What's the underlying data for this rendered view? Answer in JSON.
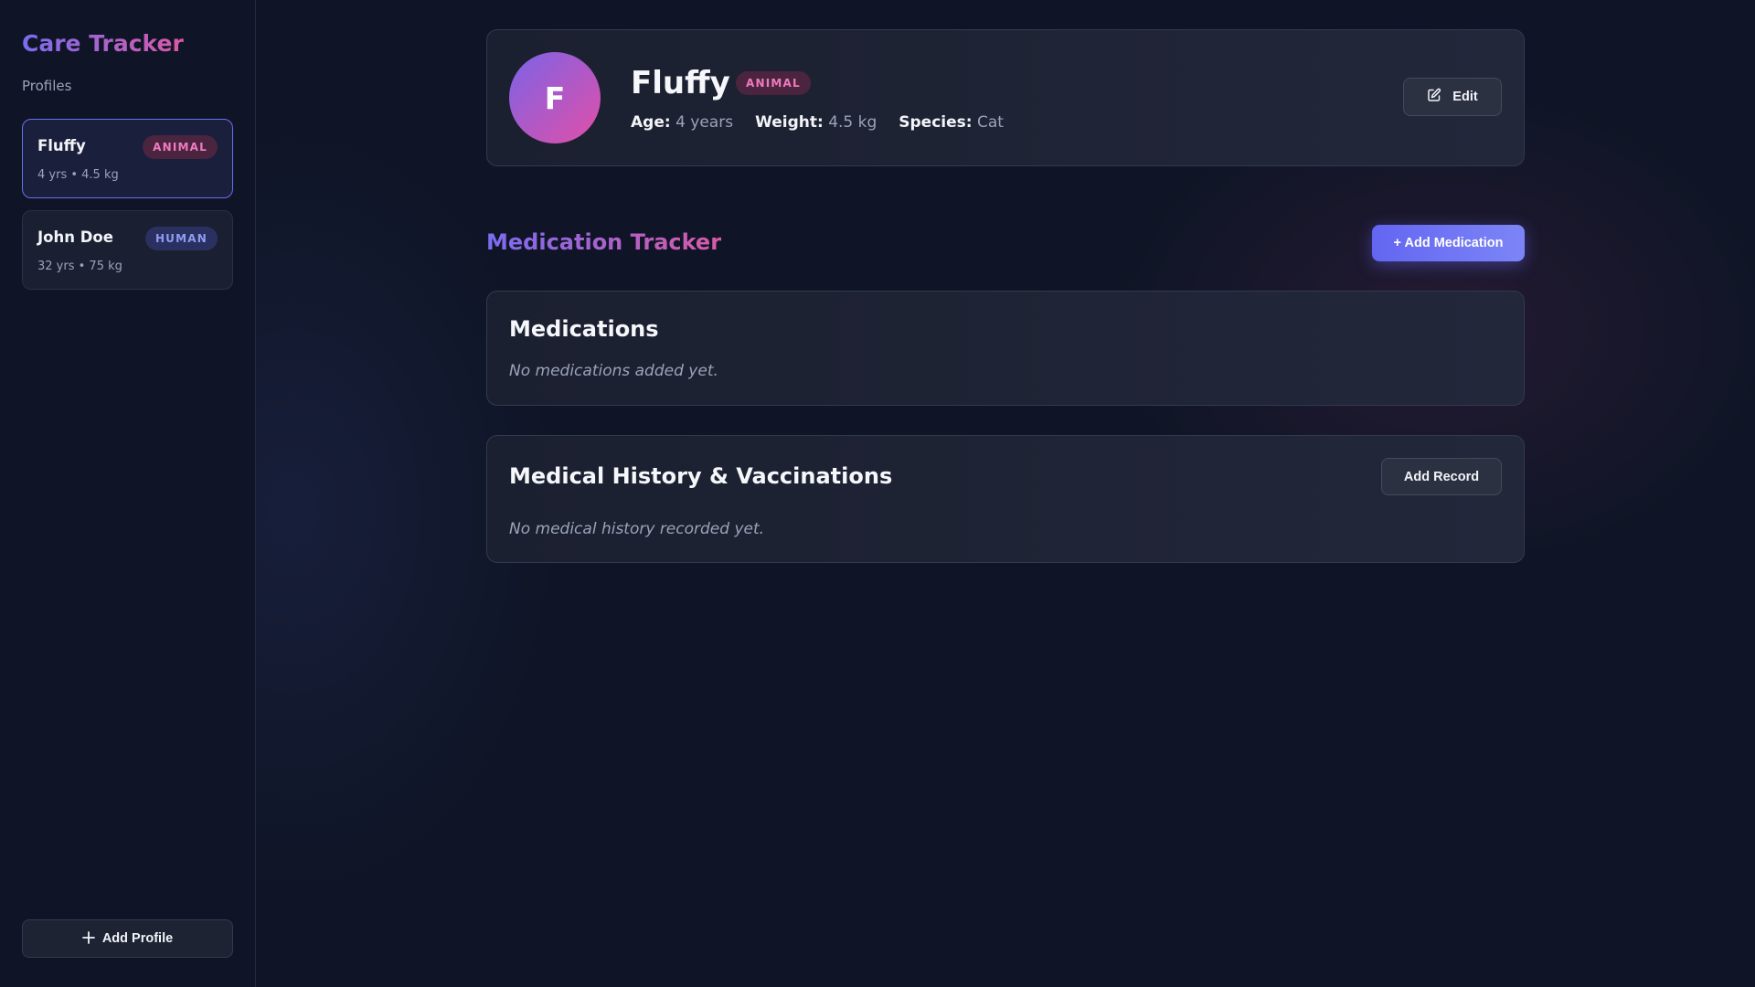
{
  "sidebar": {
    "brand": "Care Tracker",
    "section_label": "Profiles",
    "profiles": [
      {
        "name": "Fluffy",
        "badge": "ANIMAL",
        "meta": "4 yrs • 4.5 kg",
        "active": true
      },
      {
        "name": "John Doe",
        "badge": "HUMAN",
        "meta": "32 yrs • 75 kg",
        "active": false
      }
    ],
    "add_profile_label": "Add Profile",
    "add_profile_icon": "plus-icon"
  },
  "profile_header": {
    "avatar_initial": "F",
    "name": "Fluffy",
    "badge": "ANIMAL",
    "age_label": "Age:",
    "age_value": "4 years",
    "weight_label": "Weight:",
    "weight_value": "4.5 kg",
    "species_label": "Species:",
    "species_value": "Cat",
    "edit_label": "Edit",
    "edit_icon": "edit-icon"
  },
  "medication_tracker": {
    "title": "Medication Tracker",
    "add_button_label": "+ Add Medication"
  },
  "medications_card": {
    "title": "Medications",
    "empty_text": "No medications added yet."
  },
  "history_card": {
    "title": "Medical History & Vaccinations",
    "add_button_label": "Add Record",
    "empty_text": "No medical history recorded yet."
  },
  "colors": {
    "background": "#0f1526",
    "accent": "#6366f1",
    "brand_gradient_start": "#7b6cf2",
    "brand_gradient_end": "#d85aa6",
    "animal_badge_text": "#ef7bbf",
    "human_badge_text": "#8f9cf2"
  }
}
